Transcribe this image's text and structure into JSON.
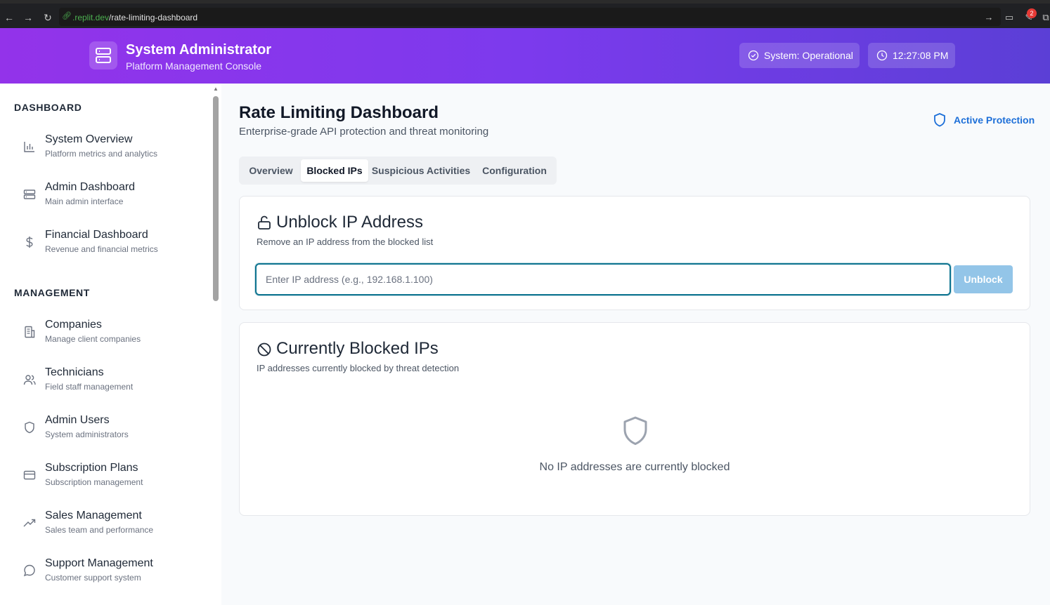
{
  "browser": {
    "url_domain": ".replit.dev",
    "url_path": "/rate-limiting-dashboard",
    "notification_count": "2"
  },
  "header": {
    "title": "System Administrator",
    "subtitle": "Platform Management Console",
    "status_label": "System: Operational",
    "time_label": "12:27:08 PM"
  },
  "sidebar": {
    "sections": [
      {
        "title": "DASHBOARD",
        "items": [
          {
            "label": "System Overview",
            "desc": "Platform metrics and analytics",
            "icon": "bar-chart-icon"
          },
          {
            "label": "Admin Dashboard",
            "desc": "Main admin interface",
            "icon": "server-icon"
          },
          {
            "label": "Financial Dashboard",
            "desc": "Revenue and financial metrics",
            "icon": "dollar-icon"
          }
        ]
      },
      {
        "title": "MANAGEMENT",
        "items": [
          {
            "label": "Companies",
            "desc": "Manage client companies",
            "icon": "building-icon"
          },
          {
            "label": "Technicians",
            "desc": "Field staff management",
            "icon": "users-icon"
          },
          {
            "label": "Admin Users",
            "desc": "System administrators",
            "icon": "shield-icon"
          },
          {
            "label": "Subscription Plans",
            "desc": "Subscription management",
            "icon": "credit-card-icon"
          },
          {
            "label": "Sales Management",
            "desc": "Sales team and performance",
            "icon": "trending-up-icon"
          },
          {
            "label": "Support Management",
            "desc": "Customer support system",
            "icon": "message-circle-icon"
          }
        ]
      }
    ]
  },
  "main": {
    "title": "Rate Limiting Dashboard",
    "subtitle": "Enterprise-grade API protection and threat monitoring",
    "protection_label": "Active Protection",
    "tabs": [
      {
        "label": "Overview",
        "active": false
      },
      {
        "label": "Blocked IPs",
        "active": true
      },
      {
        "label": "Suspicious Activities",
        "active": false
      },
      {
        "label": "Configuration",
        "active": false
      }
    ],
    "unblock_card": {
      "title": "Unblock IP Address",
      "desc": "Remove an IP address from the blocked list",
      "input_value": "",
      "input_placeholder": "Enter IP address (e.g., 192.168.1.100)",
      "button_label": "Unblock"
    },
    "blocked_card": {
      "title": "Currently Blocked IPs",
      "desc": "IP addresses currently blocked by threat detection",
      "empty_text": "No IP addresses are currently blocked"
    }
  },
  "colors": {
    "header_gradient_start": "#9333ea",
    "header_gradient_end": "#5b3fd6",
    "accent_blue": "#1d6fd8",
    "focus_ring": "#0e7490",
    "button_disabled": "#93c5e8"
  }
}
